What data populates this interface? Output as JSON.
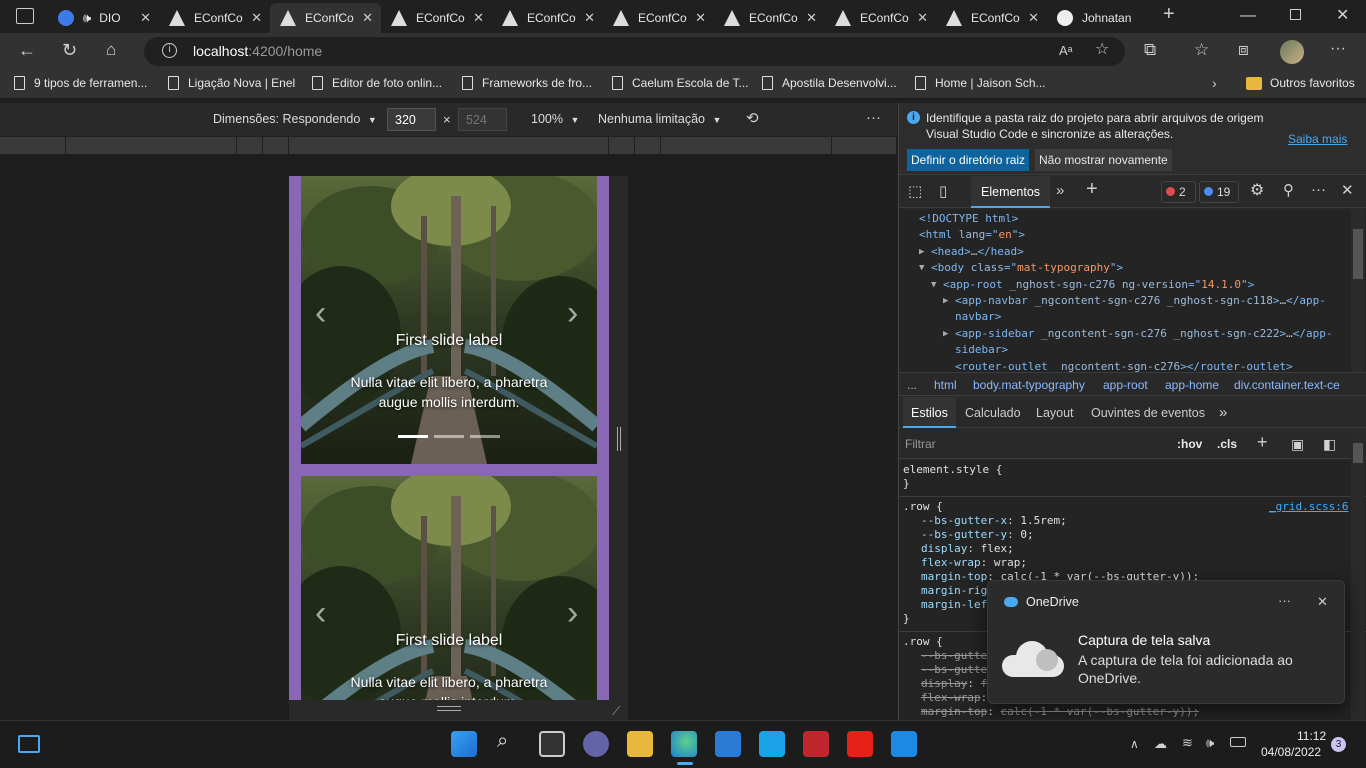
{
  "tabs": [
    {
      "title": "DIO",
      "type": "dio"
    },
    {
      "title": "EConfCo",
      "type": "angular"
    },
    {
      "title": "EConfCo",
      "type": "angular",
      "active": true
    },
    {
      "title": "EConfCo",
      "type": "angular"
    },
    {
      "title": "EConfCo",
      "type": "angular"
    },
    {
      "title": "EConfCo",
      "type": "angular"
    },
    {
      "title": "EConfCo",
      "type": "angular"
    },
    {
      "title": "EConfCo",
      "type": "angular"
    },
    {
      "title": "EConfCo",
      "type": "angular"
    },
    {
      "title": "Johnatan",
      "type": "github"
    }
  ],
  "address": {
    "host": "localhost",
    "path": ":4200/home"
  },
  "bookmarks": [
    "9 tipos de ferramen...",
    "Ligação Nova | Enel",
    "Editor de foto onlin...",
    "Frameworks de fro...",
    "Caelum Escola de T...",
    "Apostila Desenvolvi...",
    "Home | Jaison Sch..."
  ],
  "other_favorites": "Outros favoritos",
  "device": {
    "dimensions": "Dimensões: Respondendo",
    "width": "320",
    "height": "524",
    "times": "×",
    "zoom": "100%",
    "throttle": "Nenhuma limitação"
  },
  "slides": [
    {
      "label": "First slide label",
      "text": "Nulla vitae elit libero, a pharetra augue mollis interdum."
    },
    {
      "label": "First slide label",
      "text": "Nulla vitae elit libero, a pharetra augue mollis interdum."
    }
  ],
  "devtools": {
    "infobar": {
      "text": "Identifique a pasta raiz do projeto para abrir arquivos de origem Visual Studio Code e sincronize as alterações.",
      "learn_more": "Saiba mais",
      "primary_button": "Definir o diretório raiz",
      "secondary_button": "Não mostrar novamente"
    },
    "main_tab": "Elementos",
    "errors": "2",
    "warnings": "19",
    "dom_lines": [
      {
        "indent": 0,
        "parts": [
          [
            "tag",
            "<!DOCTYPE html>"
          ]
        ]
      },
      {
        "indent": 0,
        "parts": [
          [
            "tag",
            "<html "
          ],
          [
            "an",
            "lang"
          ],
          [
            "tag",
            "=\""
          ],
          [
            "av",
            "en"
          ],
          [
            "tag",
            "\">"
          ]
        ]
      },
      {
        "indent": 1,
        "arrow": "▶",
        "parts": [
          [
            "tag",
            "<head>"
          ],
          [
            "cm",
            "…"
          ],
          [
            "tag",
            "</head>"
          ]
        ]
      },
      {
        "indent": 1,
        "arrow": "▼",
        "parts": [
          [
            "tag",
            "<body "
          ],
          [
            "an",
            "class"
          ],
          [
            "tag",
            "=\""
          ],
          [
            "av",
            "mat-typography"
          ],
          [
            "tag",
            "\">"
          ]
        ]
      },
      {
        "indent": 2,
        "arrow": "▼",
        "parts": [
          [
            "tag",
            "<app-root "
          ],
          [
            "an",
            "_nghost-sgn-c276 ng-version"
          ],
          [
            "tag",
            "=\""
          ],
          [
            "av",
            "14.1.0"
          ],
          [
            "tag",
            "\">"
          ]
        ]
      },
      {
        "indent": 3,
        "arrow": "▶",
        "parts": [
          [
            "tag",
            "<app-navbar "
          ],
          [
            "an",
            "_ngcontent-sgn-c276 _nghost-sgn-c118"
          ],
          [
            "tag",
            ">"
          ],
          [
            "cm",
            "…"
          ],
          [
            "tag",
            "</app-"
          ]
        ]
      },
      {
        "indent": 3,
        "parts": [
          [
            "tag",
            "navbar>"
          ]
        ]
      },
      {
        "indent": 3,
        "arrow": "▶",
        "parts": [
          [
            "tag",
            "<app-sidebar "
          ],
          [
            "an",
            "_ngcontent-sgn-c276 _nghost-sgn-c222"
          ],
          [
            "tag",
            ">"
          ],
          [
            "cm",
            "…"
          ],
          [
            "tag",
            "</app-"
          ]
        ]
      },
      {
        "indent": 3,
        "parts": [
          [
            "tag",
            "sidebar>"
          ]
        ]
      },
      {
        "indent": 3,
        "parts": [
          [
            "tag",
            "<router-outlet "
          ],
          [
            "an",
            "_ngcontent-sgn-c276"
          ],
          [
            "tag",
            "></router-outlet>"
          ]
        ]
      }
    ],
    "breadcrumbs": [
      "...",
      "html",
      "body.mat-typography",
      "app-root",
      "app-home",
      "div.container.text-ce"
    ],
    "style_tabs": [
      "Estilos",
      "Calculado",
      "Layout",
      "Ouvintes de eventos"
    ],
    "filter_placeholder": "Filtrar",
    "hov": ":hov",
    "cls": ".cls",
    "element_style": "element.style {",
    "close_brace": "}",
    "rule1": {
      "selector": ".row {",
      "source": "_grid.scss:6",
      "props": [
        [
          "--bs-gutter-x",
          "1.5rem;"
        ],
        [
          "--bs-gutter-y",
          "0;"
        ],
        [
          "display",
          "flex;"
        ],
        [
          "flex-wrap",
          "wrap;"
        ],
        [
          "margin-top",
          "calc(-1 * var(--bs-gutter-y));"
        ],
        [
          "margin-righ",
          ""
        ],
        [
          "margin-lef",
          ""
        ]
      ]
    },
    "rule2": {
      "selector": ".row {",
      "props": [
        [
          "--bs-gutte",
          ""
        ],
        [
          "--bs-gutte",
          ""
        ],
        [
          "display",
          "f"
        ],
        [
          "flex-wrap",
          ""
        ],
        [
          "margin-top",
          "calc(-1 * var(--bs-gutter-y));"
        ]
      ]
    }
  },
  "toast": {
    "app": "OneDrive",
    "title": "Captura de tela salva",
    "body": "A captura de tela foi adicionada ao OneDrive.",
    "more": "···",
    "close": "✕"
  },
  "tray": {
    "time": "11:12",
    "date": "04/08/2022",
    "badge": "3"
  },
  "colors": {
    "accent": "#0e639c",
    "frame": "#8a67b5",
    "link": "#4aa8f0"
  }
}
